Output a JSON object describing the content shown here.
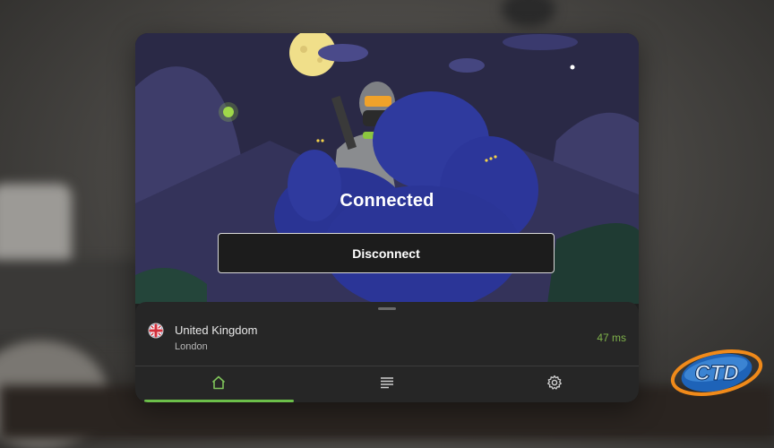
{
  "status": {
    "title": "Connected"
  },
  "actions": {
    "disconnect_label": "Disconnect"
  },
  "server": {
    "country": "United Kingdom",
    "city": "London",
    "latency": "47 ms",
    "flag_icon": "uk-flag-icon"
  },
  "nav": {
    "items": [
      {
        "name": "home",
        "icon": "home-icon",
        "active": true
      },
      {
        "name": "servers",
        "icon": "list-icon",
        "active": false
      },
      {
        "name": "settings",
        "icon": "gear-icon",
        "active": false
      }
    ]
  },
  "colors": {
    "accent": "#6cbf4a",
    "latency": "#7fb24a",
    "sky": "#2a2946",
    "bush": "#2f3a9e"
  },
  "watermark": {
    "text": "CTD"
  }
}
